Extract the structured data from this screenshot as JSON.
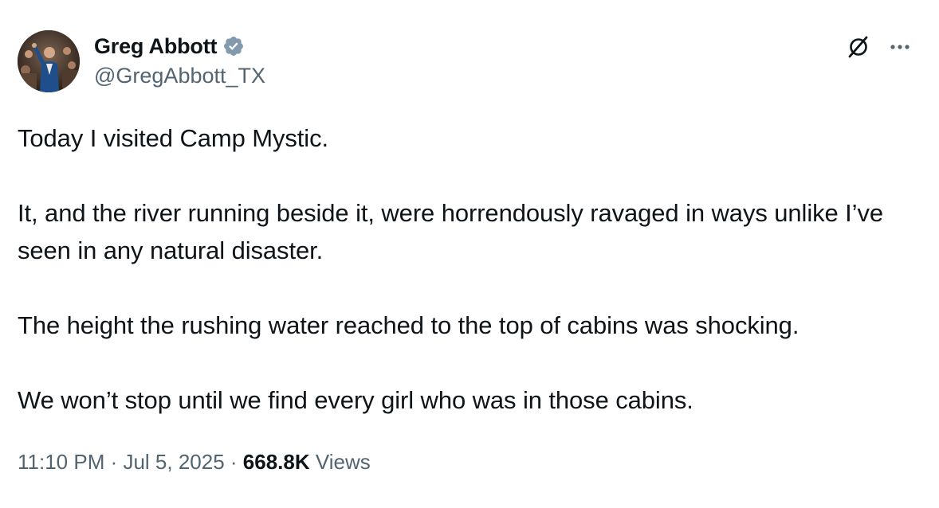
{
  "author": {
    "display_name": "Greg Abbott",
    "handle": "@GregAbbott_TX",
    "verified_badge_color": "#829aab",
    "avatar_icon": "profile-photo"
  },
  "actions": {
    "grok_icon": "grok-icon",
    "more_icon": "more-icon"
  },
  "tweet": {
    "paragraphs": [
      "Today I visited Camp Mystic.",
      "It, and the river running beside it, were horrendously ravaged in ways unlike I’ve seen in any natural disaster.",
      "The height the rushing water reached to the top of cabins was shocking.",
      "We won’t stop until we find every girl who was in those cabins."
    ]
  },
  "meta": {
    "time": "11:10 PM",
    "separator": " · ",
    "date": "Jul 5, 2025",
    "views_count": "668.8K",
    "views_label": "Views"
  },
  "colors": {
    "text_primary": "#0f1419",
    "text_secondary": "#536471"
  }
}
